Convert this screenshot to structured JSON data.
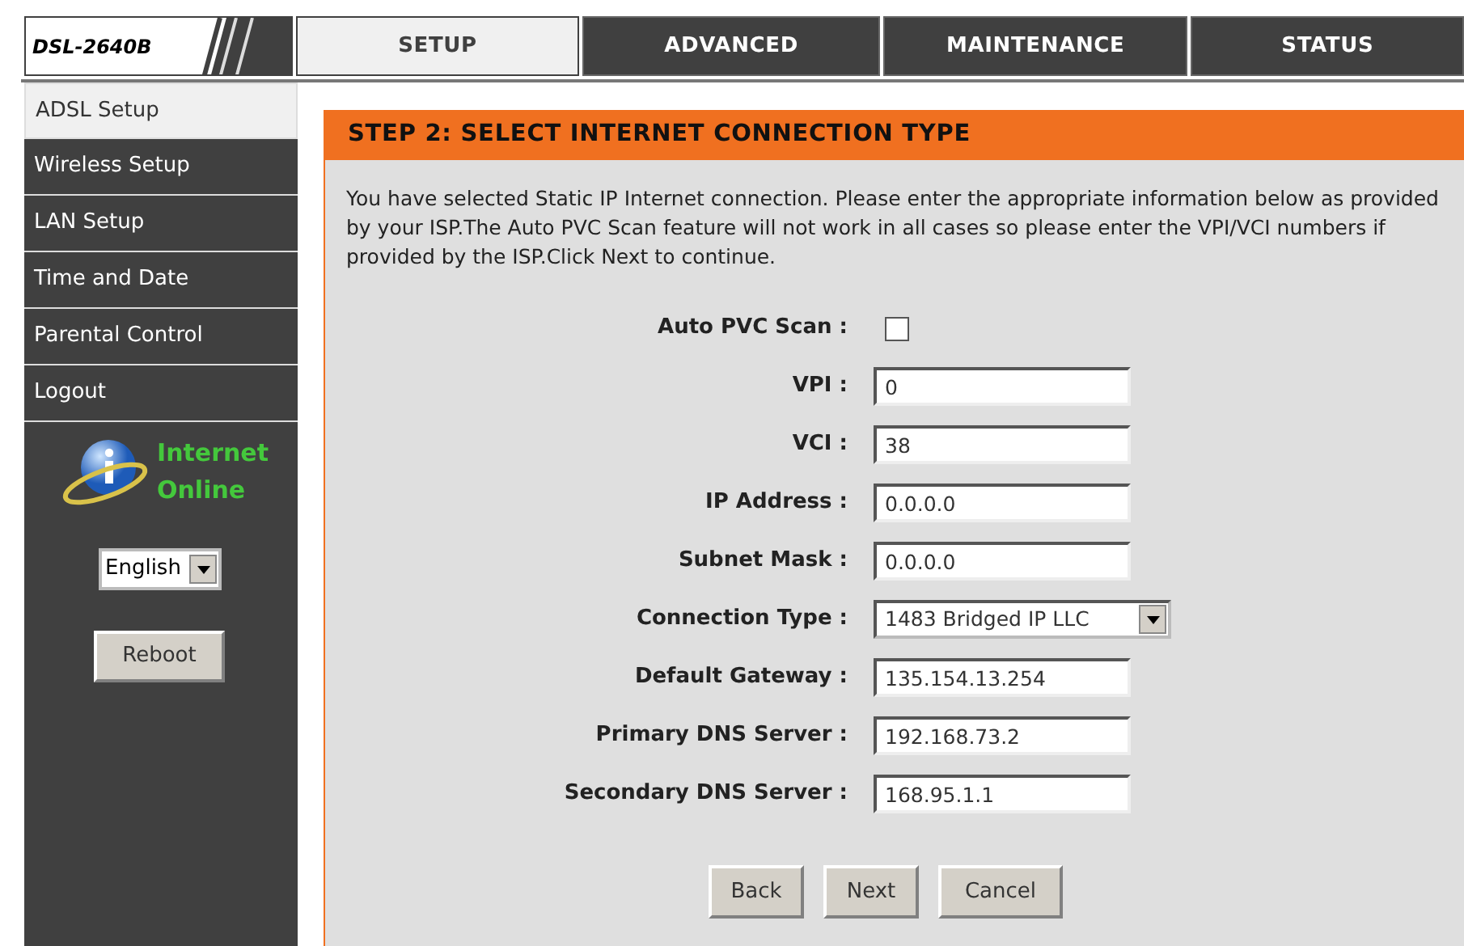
{
  "logo": {
    "model": "DSL-2640B"
  },
  "tabs": [
    {
      "label": "SETUP",
      "selected": true
    },
    {
      "label": "ADVANCED",
      "selected": false
    },
    {
      "label": "MAINTENANCE",
      "selected": false
    },
    {
      "label": "STATUS",
      "selected": false
    }
  ],
  "sidebar": {
    "items": [
      {
        "label": "ADSL Setup",
        "selected": true
      },
      {
        "label": "Wireless Setup",
        "selected": false
      },
      {
        "label": "LAN Setup",
        "selected": false
      },
      {
        "label": "Time and Date",
        "selected": false
      },
      {
        "label": "Parental Control",
        "selected": false
      },
      {
        "label": "Logout",
        "selected": false
      }
    ],
    "status": {
      "line1": "Internet",
      "line2": "Online"
    },
    "language": "English",
    "reboot": "Reboot"
  },
  "panel": {
    "title": "STEP 2: SELECT INTERNET CONNECTION TYPE",
    "description": "You have selected Static IP Internet connection. Please enter the appropriate information below as provided by your ISP.The Auto PVC Scan feature will not work in all cases so please enter the VPI/VCI numbers if provided by the ISP.Click Next to continue.",
    "fields": [
      {
        "kind": "checkbox",
        "label": "Auto PVC Scan :",
        "checked": false
      },
      {
        "kind": "text",
        "label": "VPI :",
        "value": "0"
      },
      {
        "kind": "text",
        "label": "VCI :",
        "value": "38"
      },
      {
        "kind": "text",
        "label": "IP Address :",
        "value": "0.0.0.0"
      },
      {
        "kind": "text",
        "label": "Subnet Mask :",
        "value": "0.0.0.0"
      },
      {
        "kind": "select",
        "label": "Connection Type :",
        "value": "1483 Bridged IP LLC"
      },
      {
        "kind": "text",
        "label": "Default Gateway :",
        "value": "135.154.13.254"
      },
      {
        "kind": "text",
        "label": "Primary DNS Server :",
        "value": "192.168.73.2"
      },
      {
        "kind": "text",
        "label": "Secondary DNS Server :",
        "value": "168.95.1.1"
      }
    ],
    "buttons": [
      "Back",
      "Next",
      "Cancel"
    ]
  }
}
